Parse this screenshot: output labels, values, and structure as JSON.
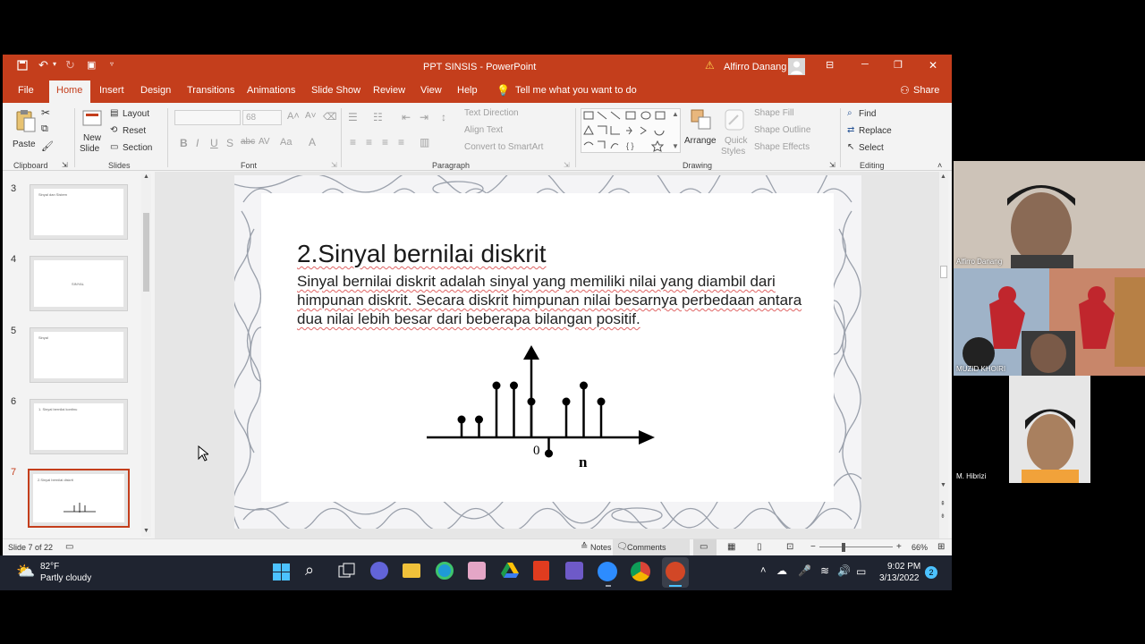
{
  "window": {
    "title": "PPT SINSIS  -  PowerPoint",
    "user": "Alfirro Danang",
    "minimize": "─",
    "restore": "❐",
    "close": "✕"
  },
  "ribbon_tabs": [
    "File",
    "Home",
    "Insert",
    "Design",
    "Transitions",
    "Animations",
    "Slide Show",
    "Review",
    "View",
    "Help"
  ],
  "tell_me": "Tell me what you want to do",
  "share": "Share",
  "ribbon": {
    "clipboard": {
      "paste": "Paste",
      "label": "Clipboard"
    },
    "slides": {
      "new_slide_1": "New",
      "new_slide_2": "Slide",
      "layout": "Layout",
      "reset": "Reset",
      "section": "Section",
      "label": "Slides"
    },
    "font": {
      "size": "68",
      "label": "Font"
    },
    "paragraph": {
      "text_direction": "Text Direction",
      "align_text": "Align Text",
      "smartart": "Convert to SmartArt",
      "label": "Paragraph"
    },
    "drawing": {
      "arrange": "Arrange",
      "quick_styles_1": "Quick",
      "quick_styles_2": "Styles",
      "shape_fill": "Shape Fill",
      "shape_outline": "Shape Outline",
      "shape_effects": "Shape Effects",
      "label": "Drawing"
    },
    "editing": {
      "find": "Find",
      "replace": "Replace",
      "select": "Select",
      "label": "Editing"
    }
  },
  "thumbnails": [
    {
      "num": "3",
      "text": "Sinyal dan Sistem"
    },
    {
      "num": "4",
      "text": "SINYAL"
    },
    {
      "num": "5",
      "text": "Sinyal"
    },
    {
      "num": "6",
      "text": "1. Sinyal bernilai kontinu"
    },
    {
      "num": "7",
      "text": "2.Sinyal bernilai diskrit"
    }
  ],
  "slide": {
    "title": "2.Sinyal bernilai diskrit",
    "body": "Sinyal bernilai diskrit adalah sinyal yang memiliki nilai yang diambil dari himpunan diskrit. Secara diskrit himpunan nilai besarnya perbedaan antara dua nilai lebih besar dari beberapa bilangan positif.",
    "zero_label": "0",
    "axis_label": "n"
  },
  "status": {
    "slide_count": "Slide 7 of 22",
    "notes": "Notes",
    "comments": "Comments",
    "zoom": "66%"
  },
  "taskbar": {
    "temp": "82°F",
    "weather": "Partly cloudy",
    "time": "9:02 PM",
    "date": "3/13/2022",
    "notif": "2"
  },
  "participants": [
    {
      "name": "Alfirro Danang"
    },
    {
      "name": "MUZID KHOIRI"
    },
    {
      "name": "M. Hibrizi"
    }
  ],
  "colors": {
    "ppt_accent": "#c43e1c",
    "selected_thumb": "#c43e1c"
  }
}
